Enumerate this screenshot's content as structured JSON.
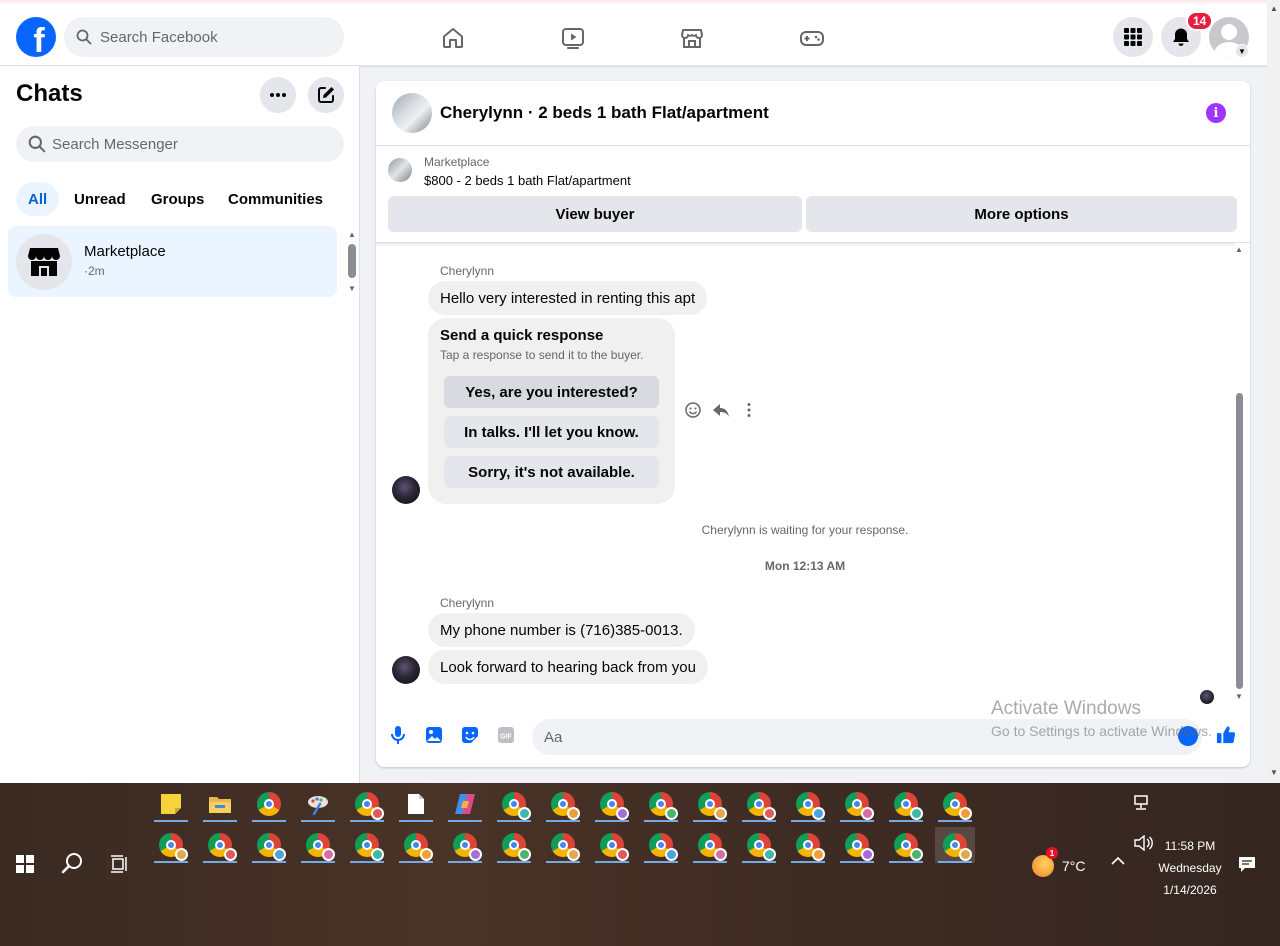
{
  "topbar": {
    "logo_letter": "f",
    "search_placeholder": "Search Facebook",
    "notifications_count": "14"
  },
  "sidebar": {
    "title": "Chats",
    "search_placeholder": "Search Messenger",
    "filters": [
      "All",
      "Unread",
      "Groups",
      "Communities"
    ],
    "chats": [
      {
        "name": "Marketplace",
        "time": "·2m"
      }
    ]
  },
  "conversation": {
    "title": "Cherylynn · 2 beds 1 bath Flat/apartment",
    "info_glyph": "i",
    "marketplace_label": "Marketplace",
    "listing": "$800 - 2 beds 1 bath Flat/apartment",
    "view_buyer": "View buyer",
    "more_options": "More options",
    "messages": {
      "sender_1": "Cherylynn",
      "msg_1": "Hello very interested in renting this apt",
      "quick_title": "Send a quick response",
      "quick_subtitle": "Tap a response to send it to the buyer.",
      "quick_options": [
        "Yes, are you interested?",
        "In talks. I'll let you know.",
        "Sorry, it's not available."
      ],
      "waiting_note": "Cherylynn is waiting for your response.",
      "timestamp": "Mon 12:13 AM",
      "sender_2": "Cherylynn",
      "msg_2": "My phone number is (716)385-0013.",
      "msg_3": "Look forward to hearing back from you"
    },
    "composer_placeholder": "Aa"
  },
  "watermark": {
    "line1": "Activate Windows",
    "line2": "Go to Settings to activate Windows."
  },
  "taskbar": {
    "weather_temp": "7°C",
    "weather_badge": "1",
    "time": "11:58 PM",
    "day": "Wednesday",
    "date": "1/14/2026"
  },
  "colors": {
    "facebook_blue": "#0866ff",
    "selected_bg": "#ebf5ff",
    "badge_red": "#e41e3f",
    "info_purple": "#a033ff"
  }
}
